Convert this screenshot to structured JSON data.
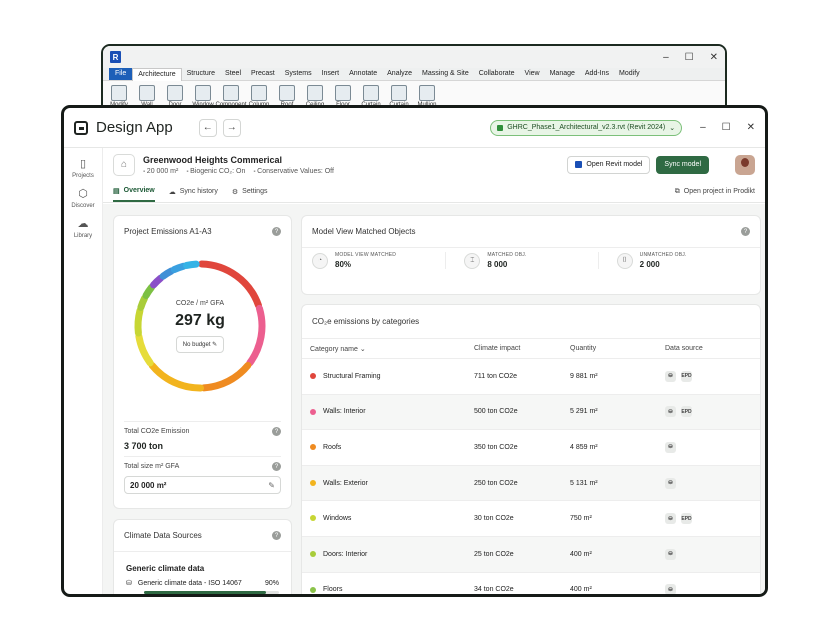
{
  "revit": {
    "logo": "R",
    "menu": [
      "File",
      "Architecture",
      "Structure",
      "Steel",
      "Precast",
      "Systems",
      "Insert",
      "Annotate",
      "Analyze",
      "Massing & Site",
      "Collaborate",
      "View",
      "Manage",
      "Add-Ins",
      "Modify"
    ],
    "tools": [
      "Modify",
      "Wall",
      "Door",
      "Window",
      "Component",
      "Column",
      "Roof",
      "Ceiling",
      "Floor",
      "Curtain",
      "Curtain",
      "Mullion"
    ]
  },
  "app": {
    "title": "Design App",
    "file_chip": "GHRC_Phase1_Architectural_v2.3.rvt (Revit 2024)"
  },
  "sidenav": [
    {
      "label": "Projects",
      "icon": "projects-icon"
    },
    {
      "label": "Discover",
      "icon": "cube-icon"
    },
    {
      "label": "Library",
      "icon": "cloud-upload-icon"
    }
  ],
  "project": {
    "name": "Greenwood Heights Commerical",
    "area": "20 000 m²",
    "biogenic": "Biogenic CO₂: On",
    "conservative": "Conservative Values: Off",
    "open_revit_label": "Open Revit model",
    "sync_label": "Sync model"
  },
  "tabs": {
    "overview": "Overview",
    "sync_history": "Sync history",
    "settings": "Settings",
    "open_prodikt": "Open project in Prodikt"
  },
  "emissions": {
    "title": "Project Emissions A1-A3",
    "center_label": "CO2e / m² GFA",
    "center_value": "297 kg",
    "budget_label": "No budget",
    "total_label": "Total CO2e Emission",
    "total_value": "3 700 ton",
    "size_label": "Total size m² GFA",
    "size_value": "20 000 m²"
  },
  "climate_sources": {
    "title": "Climate Data Sources",
    "group": "Generic climate data",
    "item_label": "Generic climate data - ISO 14067",
    "item_pct": "90%",
    "item_fraction": 0.9
  },
  "matched": {
    "title": "Model View Matched Objects",
    "stats": [
      {
        "label": "MODEL VIEW MATCHED",
        "value": "80%"
      },
      {
        "label": "MATCHED OBJ.",
        "value": "8 000"
      },
      {
        "label": "UNMATCHED OBJ.",
        "value": "2 000"
      }
    ]
  },
  "categories": {
    "title": "CO₂e emissions by categories",
    "columns": [
      "Category name",
      "Climate impact",
      "Quantity",
      "Data source"
    ],
    "rows": [
      {
        "name": "Structural Framing",
        "impact": "711 ton CO2e",
        "qty": "9 881 m²",
        "color": "#e0463c",
        "epd": true
      },
      {
        "name": "Walls: Interior",
        "impact": "500 ton CO2e",
        "qty": "5 291 m²",
        "color": "#ec5f8f",
        "epd": true
      },
      {
        "name": "Roofs",
        "impact": "350 ton CO2e",
        "qty": "4 859 m²",
        "color": "#ef8b21",
        "epd": false
      },
      {
        "name": "Walls: Exterior",
        "impact": "250 ton CO2e",
        "qty": "5 131 m²",
        "color": "#f2b41e",
        "epd": false
      },
      {
        "name": "Windows",
        "impact": "30 ton CO2e",
        "qty": "750 m²",
        "color": "#c7d634",
        "epd": true
      },
      {
        "name": "Doors: Interior",
        "impact": "25 ton CO2e",
        "qty": "400 m²",
        "color": "#a8cc3a",
        "epd": false
      },
      {
        "name": "Floors",
        "impact": "34 ton CO2e",
        "qty": "400 m²",
        "color": "#8bc34a",
        "epd": false
      }
    ]
  },
  "donut_segments": [
    {
      "from": 0,
      "to": 72,
      "color": "#e0463c"
    },
    {
      "from": 72,
      "to": 128,
      "color": "#ec5f8f"
    },
    {
      "from": 128,
      "to": 178,
      "color": "#ef8b21"
    },
    {
      "from": 178,
      "to": 232,
      "color": "#f2b41e"
    },
    {
      "from": 232,
      "to": 262,
      "color": "#e6dc3a"
    },
    {
      "from": 262,
      "to": 286,
      "color": "#c7d634"
    },
    {
      "from": 286,
      "to": 298,
      "color": "#a8cc3a"
    },
    {
      "from": 298,
      "to": 310,
      "color": "#7cc043"
    },
    {
      "from": 310,
      "to": 322,
      "color": "#8a4fc8"
    },
    {
      "from": 322,
      "to": 334,
      "color": "#3f8fd6"
    },
    {
      "from": 334,
      "to": 346,
      "color": "#3aa0e0"
    },
    {
      "from": 346,
      "to": 358,
      "color": "#35b3e6"
    }
  ]
}
